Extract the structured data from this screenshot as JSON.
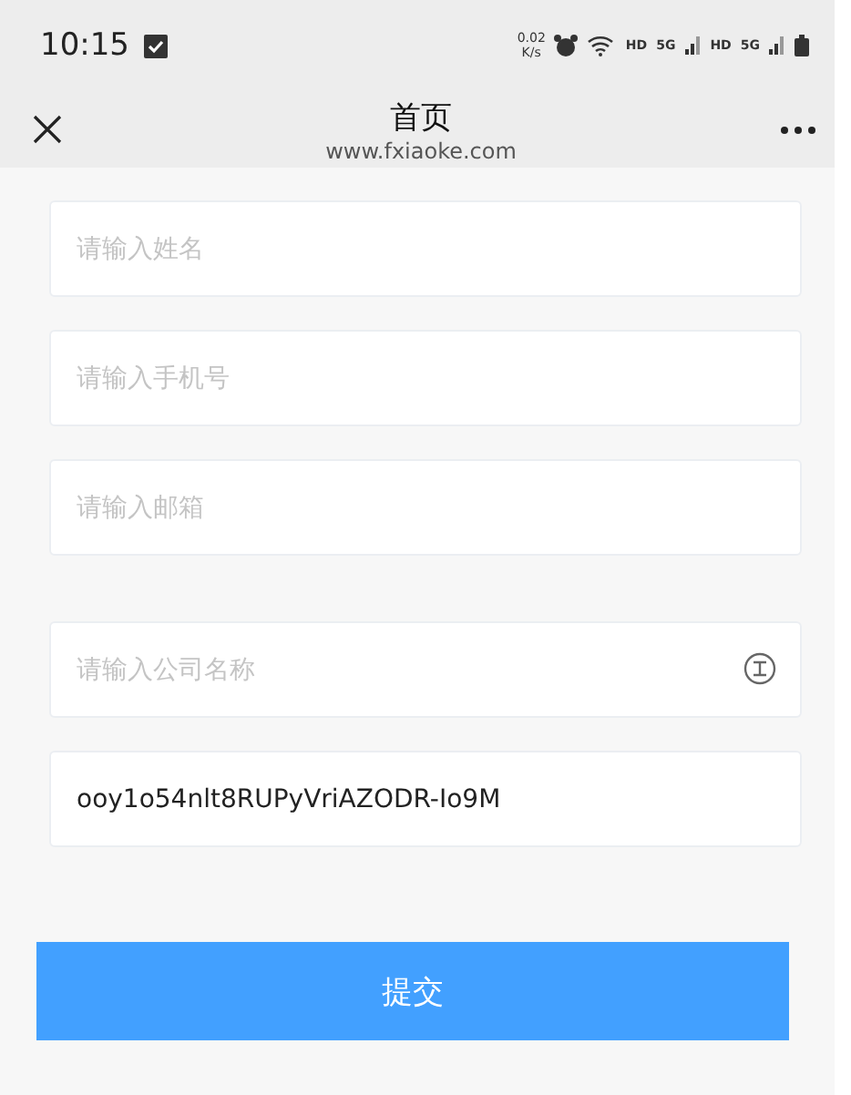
{
  "status_bar": {
    "time": "10:15",
    "speed": "0.02",
    "speed_unit": "K/s",
    "networks": [
      {
        "hd": "HD",
        "gen": "5G"
      },
      {
        "hd": "HD",
        "gen": "5G"
      }
    ]
  },
  "nav": {
    "title": "首页",
    "url": "www.fxiaoke.com"
  },
  "field_groups": [
    [
      {
        "placeholder": "请输入姓名",
        "icon": false
      },
      {
        "placeholder": "请输入手机号",
        "icon": false
      },
      {
        "placeholder": "请输入邮箱",
        "icon": false
      }
    ],
    [
      {
        "placeholder": "请输入公司名称",
        "icon": true
      },
      {
        "value": "ooy1o54nlt8RUPyVriAZODR-Io9M",
        "icon": false
      }
    ]
  ],
  "submit": {
    "label": "提交"
  }
}
